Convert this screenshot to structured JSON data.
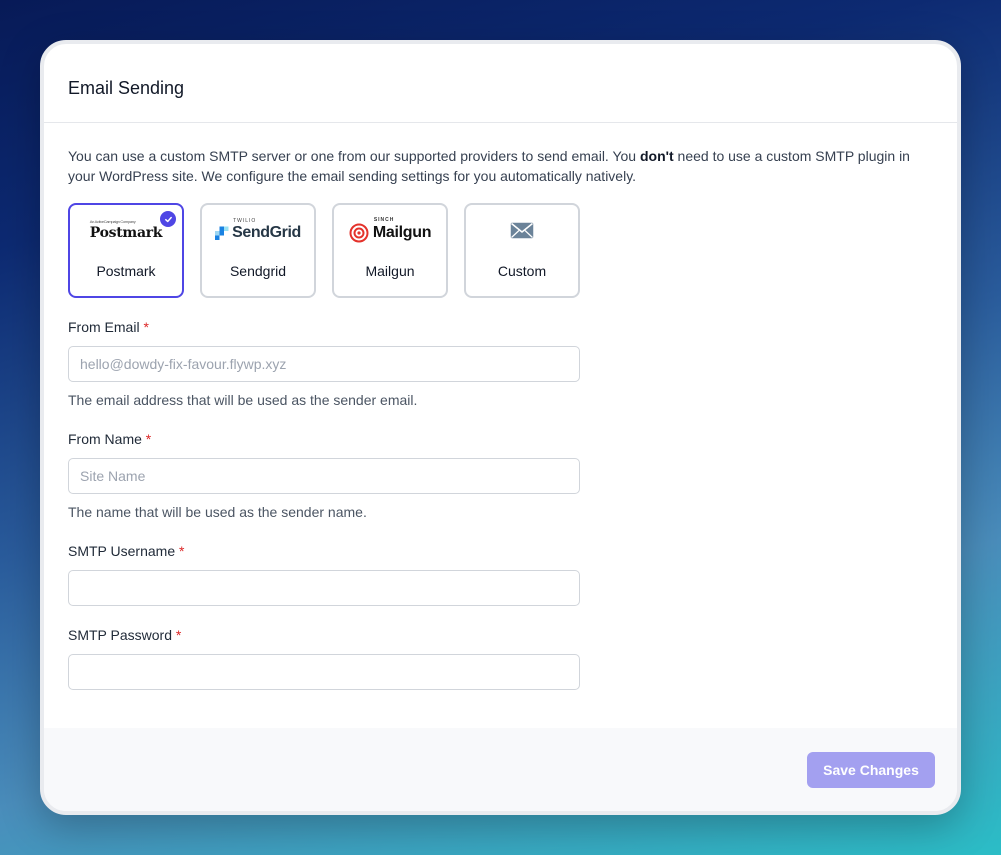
{
  "card": {
    "title": "Email Sending"
  },
  "description": {
    "before": "You can use a custom SMTP server or one from our supported providers to send email. You ",
    "bold": "don't",
    "after": " need to use a custom SMTP plugin in your WordPress site. We configure the email sending settings for you automatically natively."
  },
  "providers": [
    {
      "label": "Postmark",
      "logo_text": "Postmark",
      "logo_tagline": "An ActiveCampaign Company",
      "icon": "postmark-logo",
      "selected": true
    },
    {
      "label": "Sendgrid",
      "logo_text": "SendGrid",
      "logo_tagline": "TWILIO",
      "icon": "sendgrid-logo",
      "selected": false
    },
    {
      "label": "Mailgun",
      "logo_text": "Mailgun",
      "logo_tagline": "SINCH",
      "icon": "mailgun-logo",
      "selected": false
    },
    {
      "label": "Custom",
      "icon": "envelope-icon",
      "selected": false
    }
  ],
  "fields": {
    "from_email": {
      "label": "From Email",
      "required_mark": "*",
      "placeholder": "hello@dowdy-fix-favour.flywp.xyz",
      "value": "",
      "help": "The email address that will be used as the sender email."
    },
    "from_name": {
      "label": "From Name",
      "required_mark": "*",
      "placeholder": "Site Name",
      "value": "",
      "help": "The name that will be used as the sender name."
    },
    "smtp_username": {
      "label": "SMTP Username",
      "required_mark": "*",
      "placeholder": "",
      "value": ""
    },
    "smtp_password": {
      "label": "SMTP Password",
      "required_mark": "*",
      "placeholder": "",
      "value": ""
    }
  },
  "footer": {
    "save_label": "Save Changes"
  },
  "colors": {
    "accent": "#4f46e5",
    "save_button_disabled": "#a3a0f0",
    "required": "#dc2626"
  }
}
